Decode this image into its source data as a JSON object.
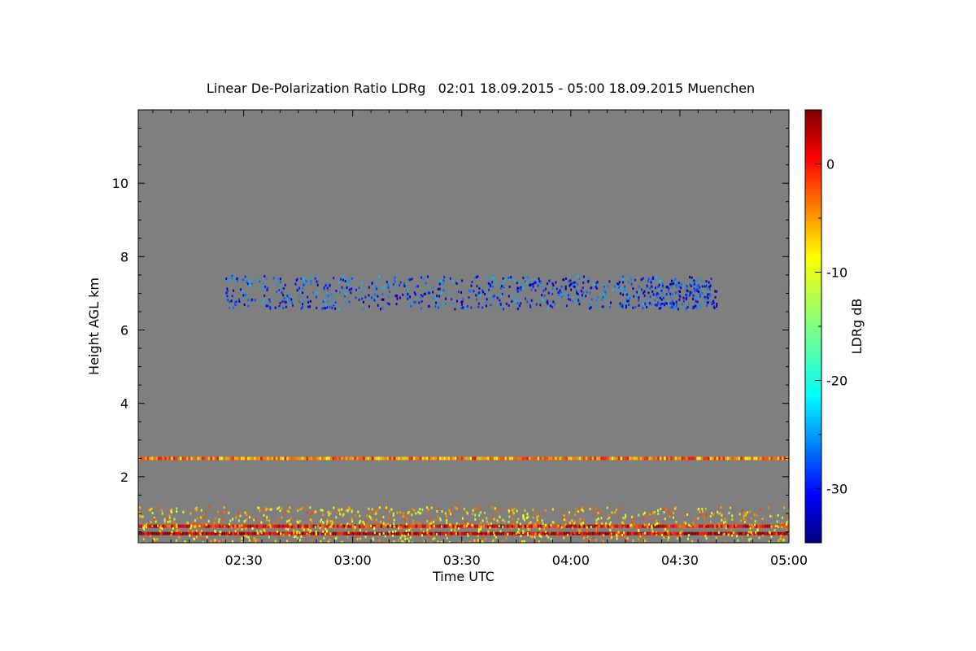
{
  "chart_data": {
    "type": "heatmap",
    "title": "Linear De-Polarization Ratio LDRg   02:01 18.09.2015 - 05:00 18.09.2015 Muenchen",
    "xlabel": "Time UTC",
    "ylabel": "Height AGL km",
    "colorbar_label": "LDRg dB",
    "x_range_min_after_0200": [
      1,
      180
    ],
    "ylim": [
      0.2,
      12
    ],
    "x_ticks": [
      {
        "label": "02:30",
        "value": 30
      },
      {
        "label": "03:00",
        "value": 60
      },
      {
        "label": "03:30",
        "value": 90
      },
      {
        "label": "04:00",
        "value": 120
      },
      {
        "label": "04:30",
        "value": 150
      },
      {
        "label": "05:00",
        "value": 180
      }
    ],
    "y_ticks": [
      2,
      4,
      6,
      8,
      10
    ],
    "colorbar_range": [
      -35,
      5
    ],
    "colorbar_ticks": [
      0,
      -10,
      -20,
      -30
    ],
    "background_color": "#7f7f7f",
    "features": [
      {
        "name": "cirrus layer",
        "t_start": 25,
        "t_end": 160,
        "h_low": 6.6,
        "h_high": 7.5,
        "ldr_db": -28
      },
      {
        "name": "dense cirrus patch",
        "t_start": 143,
        "t_end": 160,
        "h_low": 6.6,
        "h_high": 7.3,
        "ldr_db": -30
      },
      {
        "name": "layer 2.5 km",
        "t_start": 1,
        "t_end": 180,
        "h": 2.5,
        "ldr_db": -5
      },
      {
        "name": "boundary layer band 0.65 km",
        "t_start": 1,
        "t_end": 180,
        "h": 0.65,
        "ldr_db": 0
      },
      {
        "name": "boundary layer band 0.45 km",
        "t_start": 1,
        "t_end": 180,
        "h": 0.45,
        "ldr_db": 3
      },
      {
        "name": "near-ground noise",
        "t_start": 1,
        "t_end": 180,
        "h_low": 0.2,
        "h_high": 1.2,
        "ldr_db": -8
      }
    ]
  }
}
